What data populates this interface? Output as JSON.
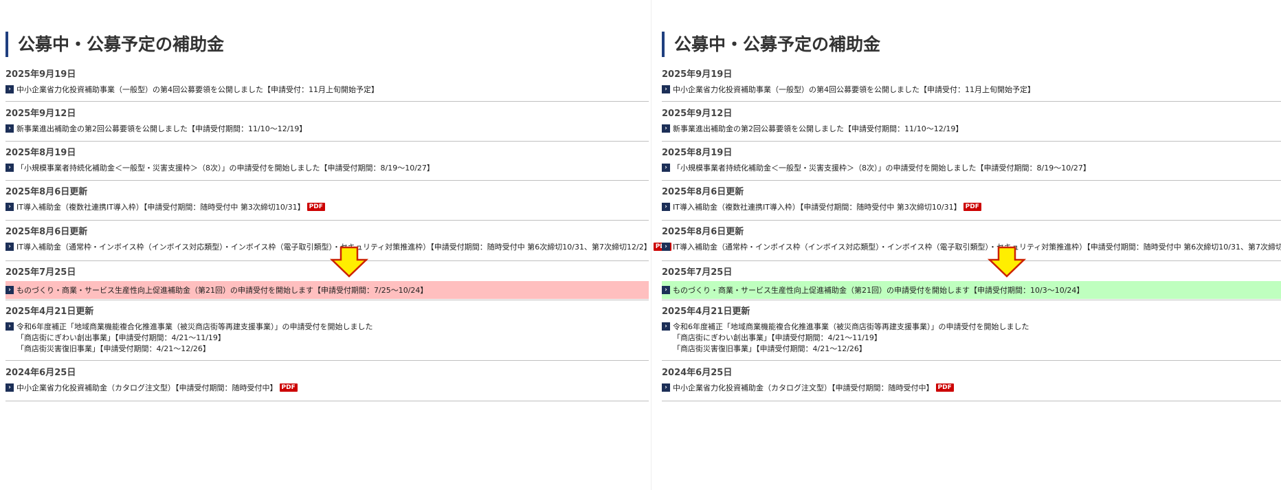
{
  "title": "公募中・公募予定の補助金",
  "pdf_label": "PDF",
  "chevron_glyph": "›",
  "colors": {
    "accent_bar": "#1f3f7f",
    "chevron_bg": "#1c2f57",
    "pdf_bg": "#cc0000",
    "highlight_before": "#ffbfbf",
    "highlight_after": "#bfffbf",
    "arrow_fill": "#ffee00",
    "arrow_stroke": "#cc2200"
  },
  "entries": [
    {
      "date": "2025年9月19日",
      "text": "中小企業省力化投資補助事業（一般型）の第4回公募要領を公開しました【申請受付：11月上旬開始予定】"
    },
    {
      "date": "2025年9月12日",
      "text": "新事業進出補助金の第2回公募要領を公開しました【申請受付期間：11/10～12/19】"
    },
    {
      "date": "2025年8月19日",
      "text": "「小規模事業者持続化補助金＜一般型・災害支援枠＞（8次）」の申請受付を開始しました【申請受付期間：8/19～10/27】"
    },
    {
      "date": "2025年8月6日更新",
      "text": "IT導入補助金（複数社連携IT導入枠）【申請受付期間：随時受付中 第3次締切10/31】"
    },
    {
      "date": "2025年8月6日更新",
      "text": "IT導入補助金（通常枠・インボイス枠（インボイス対応類型）・インボイス枠（電子取引類型）・セキュリティ対策推進枠）【申請受付期間：随時受付中 第6次締切10/31、第7次締切12/2】"
    },
    {
      "date": "2025年7月25日",
      "text_before": "ものづくり・商業・サービス生産性向上促進補助金（第21回）の申請受付を開始します【申請受付期間：7/25～10/24】",
      "text_after": "ものづくり・商業・サービス生産性向上促進補助金（第21回）の申請受付を開始します【申請受付期間：10/3～10/24】"
    },
    {
      "date": "2025年4月21日更新",
      "text": "令和6年度補正「地域商業機能複合化推進事業（被災商店街等再建支援事業）」の申請受付を開始しました",
      "sub1": "「商店街にぎわい創出事業」【申請受付期間：4/21～11/19】",
      "sub2": "「商店街災害復旧事業」【申請受付期間：4/21～12/26】"
    },
    {
      "date": "2024年6月25日",
      "text": "中小企業省力化投資補助金（カタログ注文型）【申請受付期間：随時受付中】"
    }
  ]
}
